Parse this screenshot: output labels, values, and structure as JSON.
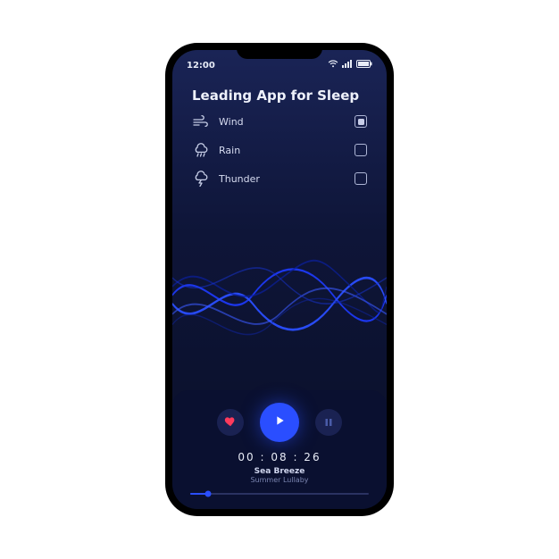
{
  "status": {
    "time": "12:00"
  },
  "header": {
    "title": "Leading App for Sleep"
  },
  "sounds": [
    {
      "icon": "wind-icon",
      "label": "Wind",
      "checked": true
    },
    {
      "icon": "rain-icon",
      "label": "Rain",
      "checked": false
    },
    {
      "icon": "thunder-icon",
      "label": "Thunder",
      "checked": false
    }
  ],
  "player": {
    "timer": "00 : 08 : 26",
    "track_title": "Sea Breeze",
    "track_subtitle": "Summer Lullaby",
    "progress_percent": 10
  },
  "colors": {
    "accent": "#2a4eff",
    "heart": "#ff3a5c"
  }
}
